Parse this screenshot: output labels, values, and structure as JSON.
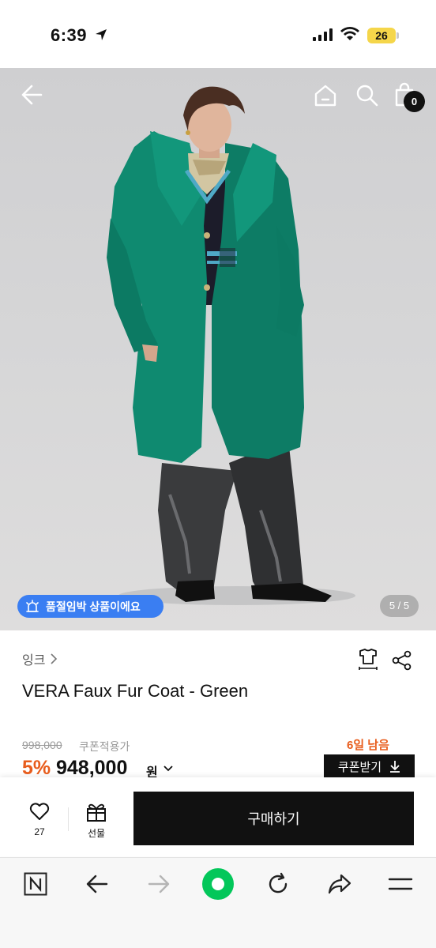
{
  "status_bar": {
    "time": "6:39",
    "battery": "26"
  },
  "header_icons": [
    "back-arrow-icon",
    "home-icon",
    "search-icon",
    "shopping-bag-icon"
  ],
  "cart_count": "0",
  "image_badge": {
    "label": "품절임박 상품이에요",
    "icon": "alarm-icon"
  },
  "image_pager": "5 / 5",
  "product": {
    "brand": "잉크",
    "title": "VERA Faux Fur Coat - Green",
    "original_price": "998,000",
    "coupon_label": "쿠폰적용가",
    "days_left": "6일 남음",
    "discount": "5%",
    "price": "948,000",
    "currency": "원",
    "coupon_button": "쿠폰받기"
  },
  "purchase_bar": {
    "like_count": "27",
    "gift_label": "선물",
    "buy_label": "구매하기"
  },
  "browser_bar": {
    "icons": [
      "naver-n-icon",
      "back-icon",
      "forward-icon",
      "green-dot-icon",
      "refresh-icon",
      "share-icon",
      "menu-icon"
    ]
  },
  "colors": {
    "accent_orange": "#e85d1d",
    "badge_blue": "#3a7ef2",
    "coat_green": "#0f8a70",
    "naver_green": "#03c75a"
  }
}
